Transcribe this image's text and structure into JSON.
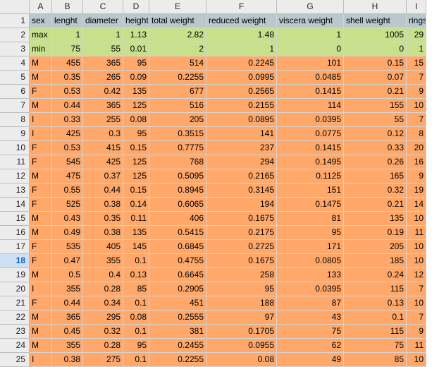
{
  "colors": {
    "header_band": "#b8c8cc",
    "limits_band": "#c8e08c",
    "data_band": "#ffa86a",
    "active_row_header": "#cfe0f5"
  },
  "active_row": "18",
  "columns": [
    "A",
    "B",
    "C",
    "D",
    "E",
    "F",
    "G",
    "H",
    "I"
  ],
  "row_numbers": [
    "1",
    "2",
    "3",
    "4",
    "5",
    "6",
    "7",
    "8",
    "9",
    "10",
    "11",
    "12",
    "13",
    "14",
    "15",
    "16",
    "17",
    "18",
    "19",
    "20",
    "21",
    "22",
    "23",
    "24",
    "25"
  ],
  "rows": [
    [
      "sex",
      "lenght",
      "diameter",
      "height",
      "total weight",
      "reduced weight",
      "viscera weight",
      "shell weight",
      "rings"
    ],
    [
      "max",
      "1",
      "1",
      "1.13",
      "2.82",
      "1.48",
      "1",
      "1005",
      "29"
    ],
    [
      "min",
      "75",
      "55",
      "0.01",
      "2",
      "1",
      "0",
      "0",
      "1"
    ],
    [
      "M",
      "455",
      "365",
      "95",
      "514",
      "0.2245",
      "101",
      "0.15",
      "15"
    ],
    [
      "M",
      "0.35",
      "265",
      "0.09",
      "0.2255",
      "0.0995",
      "0.0485",
      "0.07",
      "7"
    ],
    [
      "F",
      "0.53",
      "0.42",
      "135",
      "677",
      "0.2565",
      "0.1415",
      "0.21",
      "9"
    ],
    [
      "M",
      "0.44",
      "365",
      "125",
      "516",
      "0.2155",
      "114",
      "155",
      "10"
    ],
    [
      "I",
      "0.33",
      "255",
      "0.08",
      "205",
      "0.0895",
      "0.0395",
      "55",
      "7"
    ],
    [
      "I",
      "425",
      "0.3",
      "95",
      "0.3515",
      "141",
      "0.0775",
      "0.12",
      "8"
    ],
    [
      "F",
      "0.53",
      "415",
      "0.15",
      "0.7775",
      "237",
      "0.1415",
      "0.33",
      "20"
    ],
    [
      "F",
      "545",
      "425",
      "125",
      "768",
      "294",
      "0.1495",
      "0.26",
      "16"
    ],
    [
      "M",
      "475",
      "0.37",
      "125",
      "0.5095",
      "0.2165",
      "0.1125",
      "165",
      "9"
    ],
    [
      "F",
      "0.55",
      "0.44",
      "0.15",
      "0.8945",
      "0.3145",
      "151",
      "0.32",
      "19"
    ],
    [
      "F",
      "525",
      "0.38",
      "0.14",
      "0.6065",
      "194",
      "0.1475",
      "0.21",
      "14"
    ],
    [
      "M",
      "0.43",
      "0.35",
      "0.11",
      "406",
      "0.1675",
      "81",
      "135",
      "10"
    ],
    [
      "M",
      "0.49",
      "0.38",
      "135",
      "0.5415",
      "0.2175",
      "95",
      "0.19",
      "11"
    ],
    [
      "F",
      "535",
      "405",
      "145",
      "0.6845",
      "0.2725",
      "171",
      "205",
      "10"
    ],
    [
      "F",
      "0.47",
      "355",
      "0.1",
      "0.4755",
      "0.1675",
      "0.0805",
      "185",
      "10"
    ],
    [
      "M",
      "0.5",
      "0.4",
      "0.13",
      "0.6645",
      "258",
      "133",
      "0.24",
      "12"
    ],
    [
      "I",
      "355",
      "0.28",
      "85",
      "0.2905",
      "95",
      "0.0395",
      "115",
      "7"
    ],
    [
      "F",
      "0.44",
      "0.34",
      "0.1",
      "451",
      "188",
      "87",
      "0.13",
      "10"
    ],
    [
      "M",
      "365",
      "295",
      "0.08",
      "0.2555",
      "97",
      "43",
      "0.1",
      "7"
    ],
    [
      "M",
      "0.45",
      "0.32",
      "0.1",
      "381",
      "0.1705",
      "75",
      "115",
      "9"
    ],
    [
      "M",
      "355",
      "0.28",
      "95",
      "0.2455",
      "0.0955",
      "62",
      "75",
      "11"
    ],
    [
      "I",
      "0.38",
      "275",
      "0.1",
      "0.2255",
      "0.08",
      "49",
      "85",
      "10"
    ]
  ]
}
